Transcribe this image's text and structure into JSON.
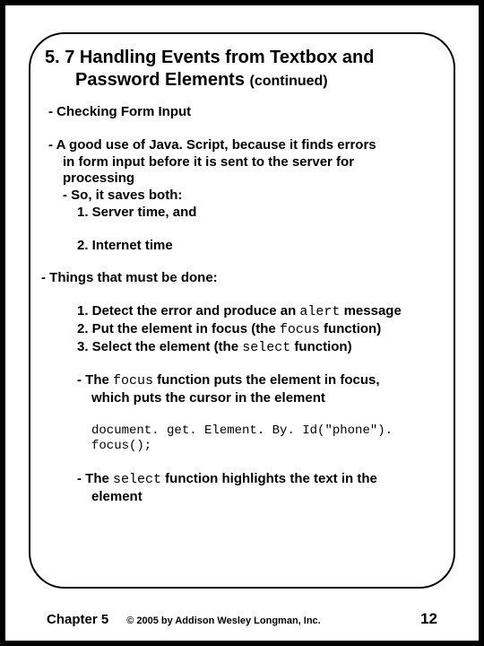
{
  "title_line1": "5. 7 Handling Events from Textbox and",
  "title_line2": "Password Elements ",
  "title_cont": "(continued)",
  "p1": "- Checking Form Input",
  "p2a": "- A good use of Java. Script, because it finds errors",
  "p2b": "in form input before it is sent to the server for",
  "p2c": "processing",
  "p2d": "- So, it saves both:",
  "p2e": "1. Server time, and",
  "p2f": "2. Internet time",
  "p3": "- Things that must be done:",
  "p3a_pre": "1. Detect the error and produce an ",
  "p3a_code": "alert",
  "p3a_post": " message",
  "p3b_pre": "2. Put the element in focus (the ",
  "p3b_code": "focus",
  "p3b_post": " function)",
  "p3c_pre": "3. Select the element (the ",
  "p3c_code": "select",
  "p3c_post": " function)",
  "p4a_pre": "- The ",
  "p4a_code": "focus",
  "p4a_post": " function puts the element in focus,",
  "p4b": "which puts the cursor in the element",
  "codeblock": "document. get. Element. By. Id(\"phone\"). focus();",
  "p5a_pre": "- The ",
  "p5a_code": "select",
  "p5a_post": " function highlights the text in the",
  "p5b": "element",
  "footer_chapter": "Chapter 5",
  "footer_copyright": "© 2005 by Addison Wesley Longman, Inc.",
  "footer_page": "12"
}
